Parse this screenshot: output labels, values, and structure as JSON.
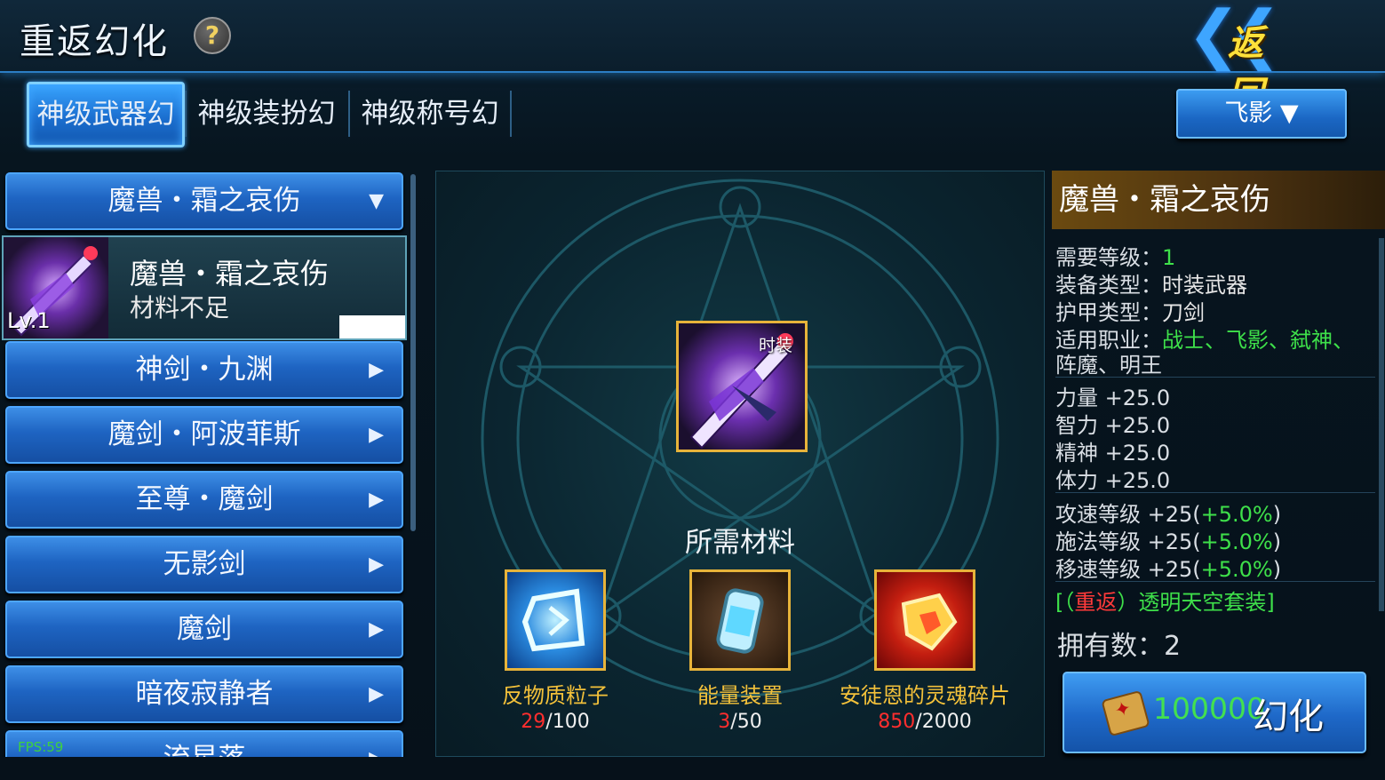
{
  "header": {
    "title": "重返幻化",
    "help_icon": "?",
    "back_label": "返回"
  },
  "tabs": [
    {
      "label": "神级武器幻",
      "active": true
    },
    {
      "label": "神级装扮幻",
      "active": false
    },
    {
      "label": "神级称号幻",
      "active": false
    }
  ],
  "class_select": {
    "value": "飞影"
  },
  "list": {
    "group_header": "魔兽・霜之哀伤",
    "selected": {
      "name": "魔兽・霜之哀伤",
      "status": "材料不足",
      "level": "Lv.1"
    },
    "items": [
      "神剑・九渊",
      "魔剑・阿波菲斯",
      "至尊・魔剑",
      "无影剑",
      "魔剑",
      "暗夜寂静者",
      "流星落"
    ]
  },
  "fps": "FPS:59",
  "center": {
    "item_tag": "时装",
    "materials_label": "所需材料",
    "materials": [
      {
        "name": "反物质粒子",
        "have": "29",
        "need": "/100"
      },
      {
        "name": "能量装置",
        "have": "3",
        "need": "/50"
      },
      {
        "name": "安徒恩的灵魂碎片",
        "have": "850",
        "need": "/2000"
      }
    ]
  },
  "detail": {
    "title": "魔兽・霜之哀伤",
    "req_level_label": "需要等级：",
    "req_level": "1",
    "equip_type_label": "装备类型：",
    "equip_type": "时装武器",
    "armor_type_label": "护甲类型：",
    "armor_type": "刀剑",
    "job_label": "适用职业：",
    "jobs_line1": "战士、飞影、弑神、",
    "jobs_line2": "阵魔、明王",
    "stats": [
      "力量 +25.0",
      "智力 +25.0",
      "精神 +25.0",
      "体力 +25.0"
    ],
    "speeds": [
      {
        "label": "攻速等级 +25(",
        "pct": "+5.0%",
        "close": ")"
      },
      {
        "label": "施法等级 +25(",
        "pct": "+5.0%",
        "close": ")"
      },
      {
        "label": "移速等级 +25(",
        "pct": "+5.0%",
        "close": ")"
      }
    ],
    "set_open": "[（",
    "set_red": "重返",
    "set_rest": "）透明天空套装]",
    "own_label": "拥有数：",
    "own_value": "2"
  },
  "transform": {
    "cost": "100000",
    "label": "幻化"
  }
}
